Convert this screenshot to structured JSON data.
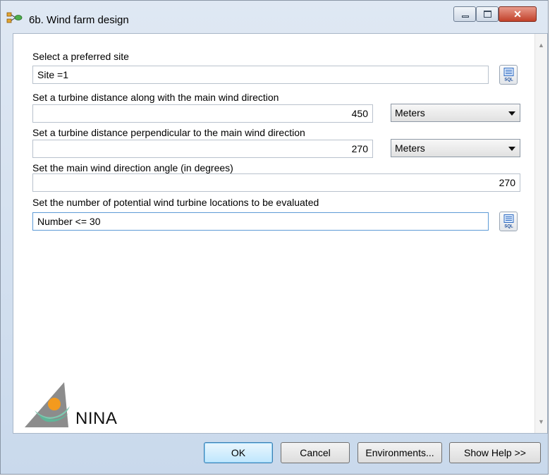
{
  "window": {
    "title": "6b. Wind farm design",
    "minimize_icon": "minimize-icon",
    "maximize_icon": "maximize-icon",
    "close_glyph": "✕"
  },
  "form": {
    "site": {
      "label": "Select a preferred site",
      "value": "Site =1",
      "icon": "sql-icon"
    },
    "distance_along": {
      "label": "Set a turbine distance along with the main wind direction",
      "value": "450",
      "unit": "Meters"
    },
    "distance_perpendicular": {
      "label": "Set a  turbine distance perpendicular to the main wind direction",
      "value": "270",
      "unit": "Meters"
    },
    "angle": {
      "label": "Set the main wind direction angle (in degrees)",
      "value": "270"
    },
    "number": {
      "label": "Set the number of potential wind turbine locations to be evaluated",
      "value": "Number <= 30",
      "icon": "sql-icon"
    }
  },
  "logo": {
    "text": "NINA"
  },
  "buttons": {
    "ok": "OK",
    "cancel": "Cancel",
    "environments": "Environments...",
    "show_help": "Show Help >>"
  },
  "colors": {
    "logo_orange": "#f39a1e",
    "logo_teal": "#7fc8b0",
    "logo_gray": "#8c8c8c",
    "focus_blue": "#5e9bd6"
  }
}
